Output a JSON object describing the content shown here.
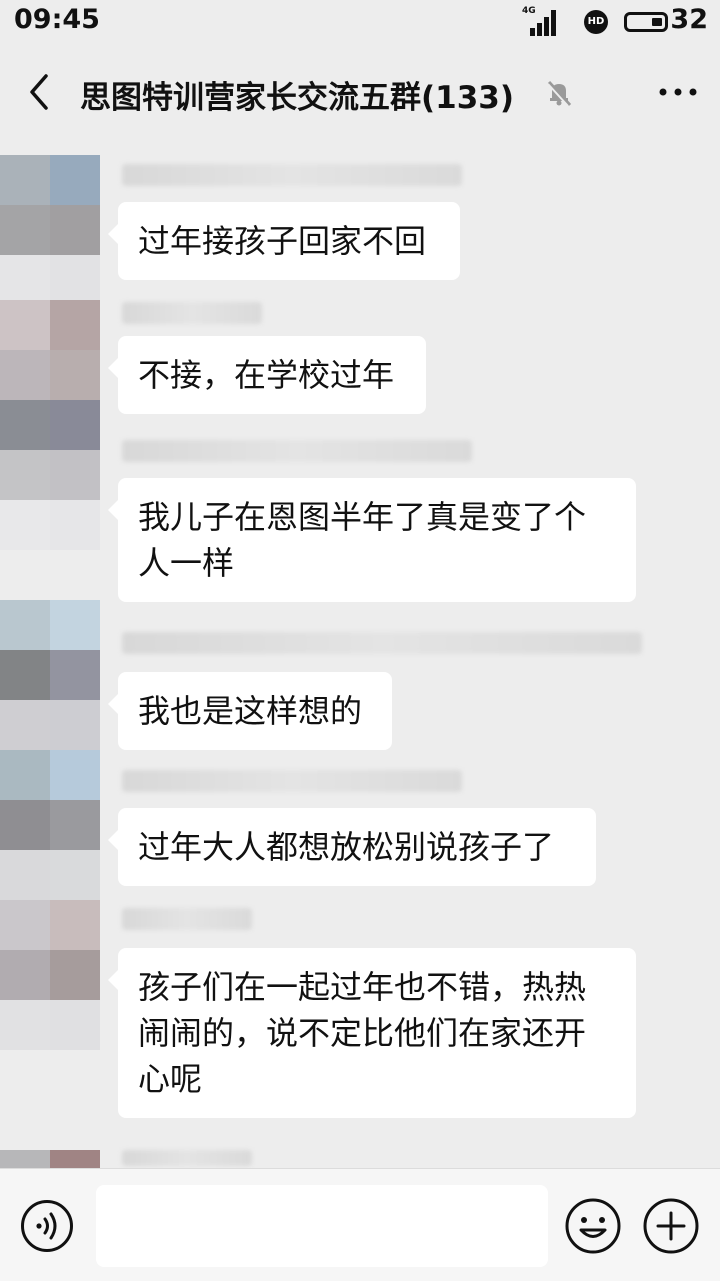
{
  "status": {
    "time": "09:45",
    "network": "4G",
    "hd": "HD",
    "battery": "32"
  },
  "header": {
    "title": "思图特训营家长交流五群(133)",
    "muted": true
  },
  "messages": [
    {
      "text": "过年接孩子回家不回",
      "avatar_colors": [
        "#aab2b9",
        "#97aabd",
        "#a4a4a6",
        "#a19fa1",
        "#e5e5e7",
        "#e2e2e4"
      ]
    },
    {
      "text": "不接，在学校过年",
      "avatar_colors": [
        "#cdc3c5",
        "#b5a5a5",
        "#bcb6ba",
        "#b8aeae",
        "#dde1e7",
        "#e3e4e8"
      ]
    },
    {
      "text": "我儿子在恩图半年了真是变了个人一样",
      "avatar_colors": [
        "#8a8d94",
        "#898a98",
        "#c4c4c6",
        "#c2c1c5",
        "#e8e8ea",
        "#e6e6e8"
      ]
    },
    {
      "text": "我也是这样想的",
      "avatar_colors": [
        "#b9c7cf",
        "#c3d4e0",
        "#828486",
        "#9394a0",
        "#cfced2",
        "#cdcdd2"
      ]
    },
    {
      "text": "过年大人都想放松别说孩子了",
      "avatar_colors": [
        "#aab9c1",
        "#b6cadb",
        "#8f8e92",
        "#9a9a9e",
        "#d9d9db",
        "#d9dadc"
      ]
    },
    {
      "text": "孩子们在一起过年也不错，热热闹闹的，说不定比他们在家还开心呢",
      "avatar_colors": [
        "#cac7cb",
        "#c8bcbc",
        "#b1acb0",
        "#a69c9c",
        "#e1e1e3",
        "#e0e0e2"
      ]
    }
  ],
  "partial_avatar_colors": [
    "#b7b7b9",
    "#a08484"
  ],
  "input": {
    "placeholder": ""
  }
}
